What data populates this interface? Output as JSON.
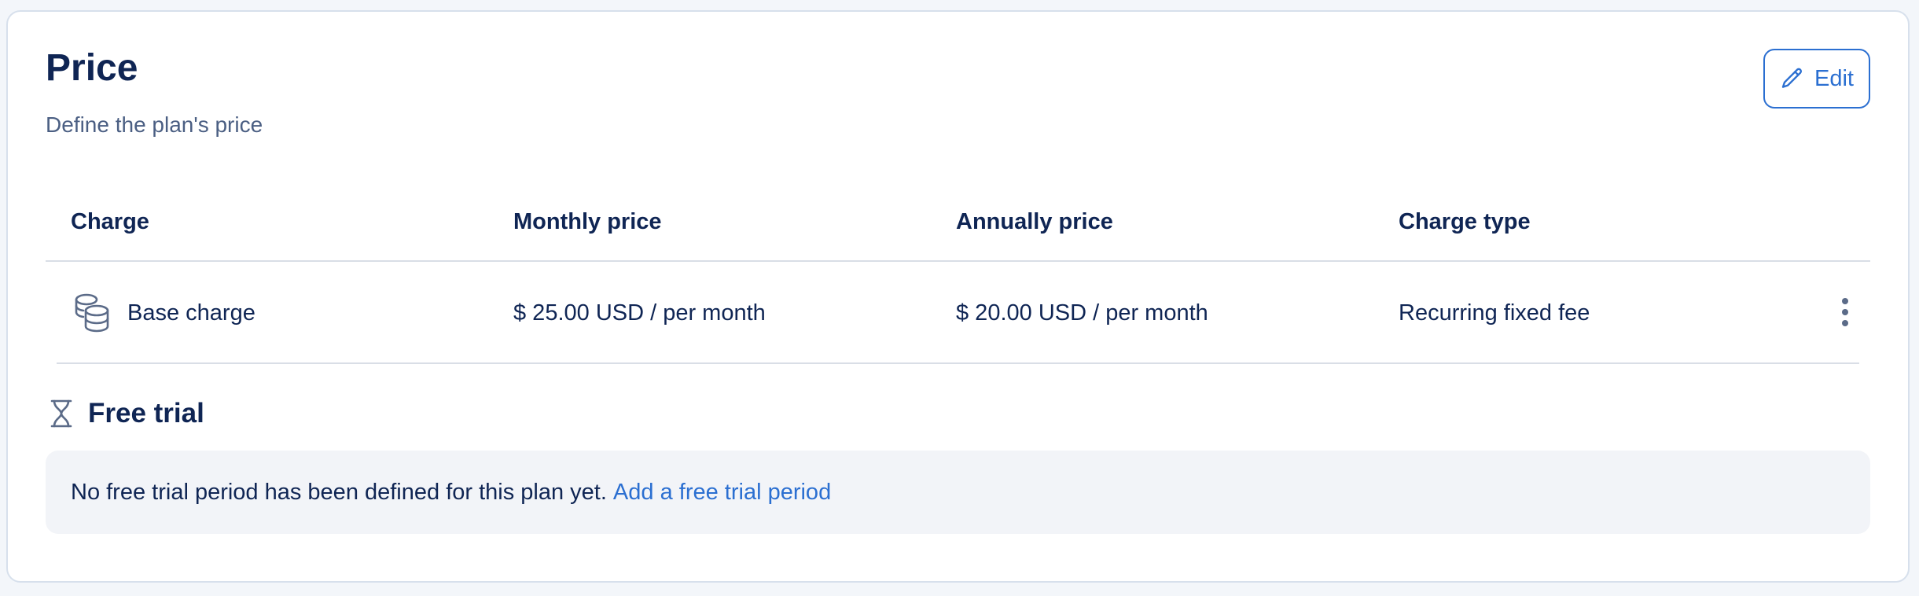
{
  "section": {
    "title": "Price",
    "subtitle": "Define the plan's price",
    "edit_label": "Edit"
  },
  "table": {
    "columns": [
      "Charge",
      "Monthly price",
      "Annually price",
      "Charge type"
    ],
    "rows": [
      {
        "charge": "Base charge",
        "monthly": "$ 25.00 USD / per month",
        "annually": "$ 20.00 USD / per month",
        "type": "Recurring fixed fee"
      }
    ]
  },
  "free_trial": {
    "title": "Free trial",
    "message": "No free trial period has been defined for this plan yet.",
    "link": "Add a free trial period"
  },
  "icons": {
    "edit": "pencil-icon",
    "charge": "coins-icon",
    "row_menu": "more-vertical-icon",
    "trial": "hourglass-icon"
  },
  "colors": {
    "text": "#0f2554",
    "muted": "#4b5f83",
    "accent": "#2b6fd1",
    "notice_bg": "#f2f4f8"
  }
}
